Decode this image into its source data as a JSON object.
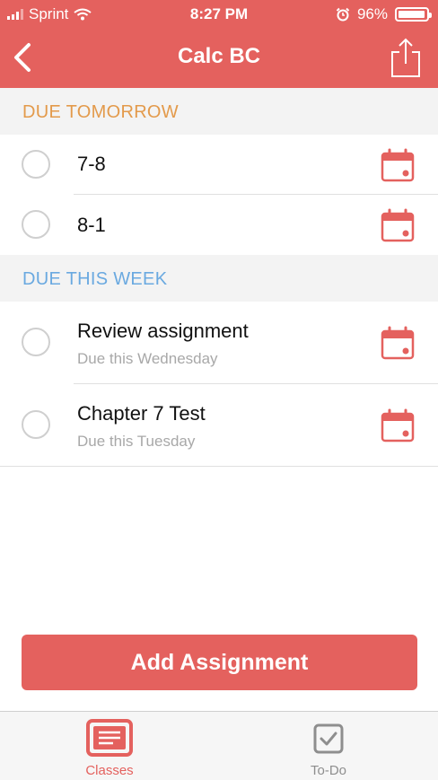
{
  "status_bar": {
    "carrier": "Sprint",
    "time": "8:27 PM",
    "battery": "96%"
  },
  "nav": {
    "title": "Calc BC"
  },
  "sections": [
    {
      "header": "DUE TOMORROW",
      "color": "#e39a4b",
      "items": [
        {
          "title": "7-8",
          "subtitle": ""
        },
        {
          "title": "8-1",
          "subtitle": ""
        }
      ]
    },
    {
      "header": "DUE THIS WEEK",
      "color": "#6aa9e0",
      "items": [
        {
          "title": "Review assignment",
          "subtitle": "Due this Wednesday"
        },
        {
          "title": "Chapter 7 Test",
          "subtitle": "Due this Tuesday"
        }
      ]
    }
  ],
  "add_button": {
    "label": "Add Assignment"
  },
  "tabbar": {
    "tabs": [
      {
        "label": "Classes",
        "icon": "classes-icon",
        "active": true
      },
      {
        "label": "To-Do",
        "icon": "todo-icon",
        "active": false
      }
    ]
  },
  "colors": {
    "accent": "#e4615e",
    "inactive": "#8e8e8e",
    "section_tomorrow": "#e39a4b",
    "section_week": "#6aa9e0"
  }
}
